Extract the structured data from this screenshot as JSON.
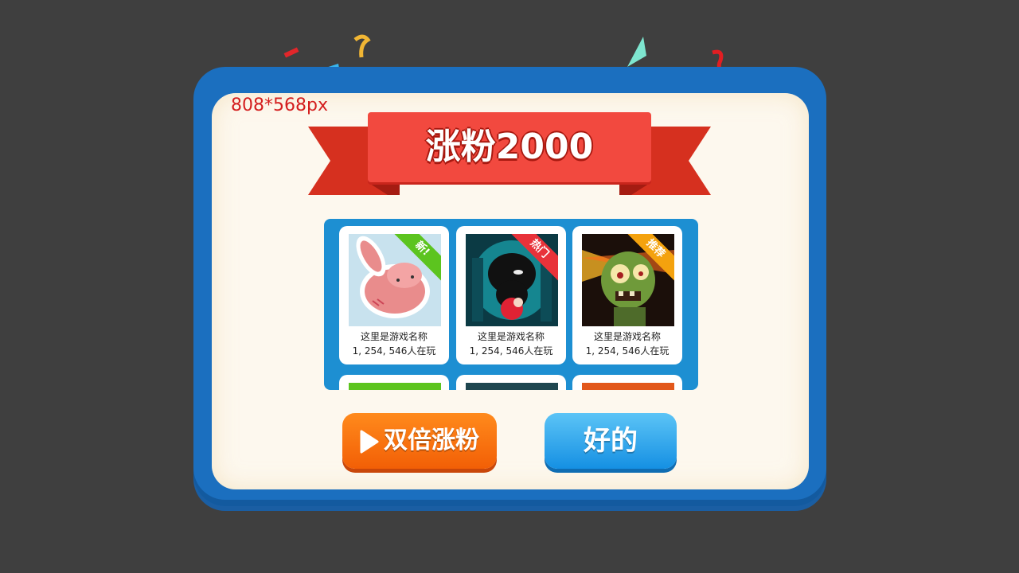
{
  "dialog": {
    "dimension_note": "808*568px",
    "title": "涨粉2000"
  },
  "games": [
    {
      "name": "这里是游戏名称",
      "players": "1, 254, 546人在玩",
      "badge": "新!",
      "badge_color": "#5cc41f",
      "art": "pink-rabbit"
    },
    {
      "name": "这里是游戏名称",
      "players": "1, 254, 546人在玩",
      "badge": "热门",
      "badge_color": "#e8323a",
      "art": "shadow-creature"
    },
    {
      "name": "这里是游戏名称",
      "players": "1, 254, 546人在玩",
      "badge": "推荐",
      "badge_color": "#f4a20e",
      "art": "zombie"
    }
  ],
  "buttons": {
    "double_label": "双倍涨粉",
    "ok_label": "好的"
  },
  "colors": {
    "frame": "#1b6fbf",
    "ribbon": "#f2493f",
    "panel": "#1d8fd2",
    "orange_button": "#f25f06",
    "blue_button": "#1590e3"
  }
}
